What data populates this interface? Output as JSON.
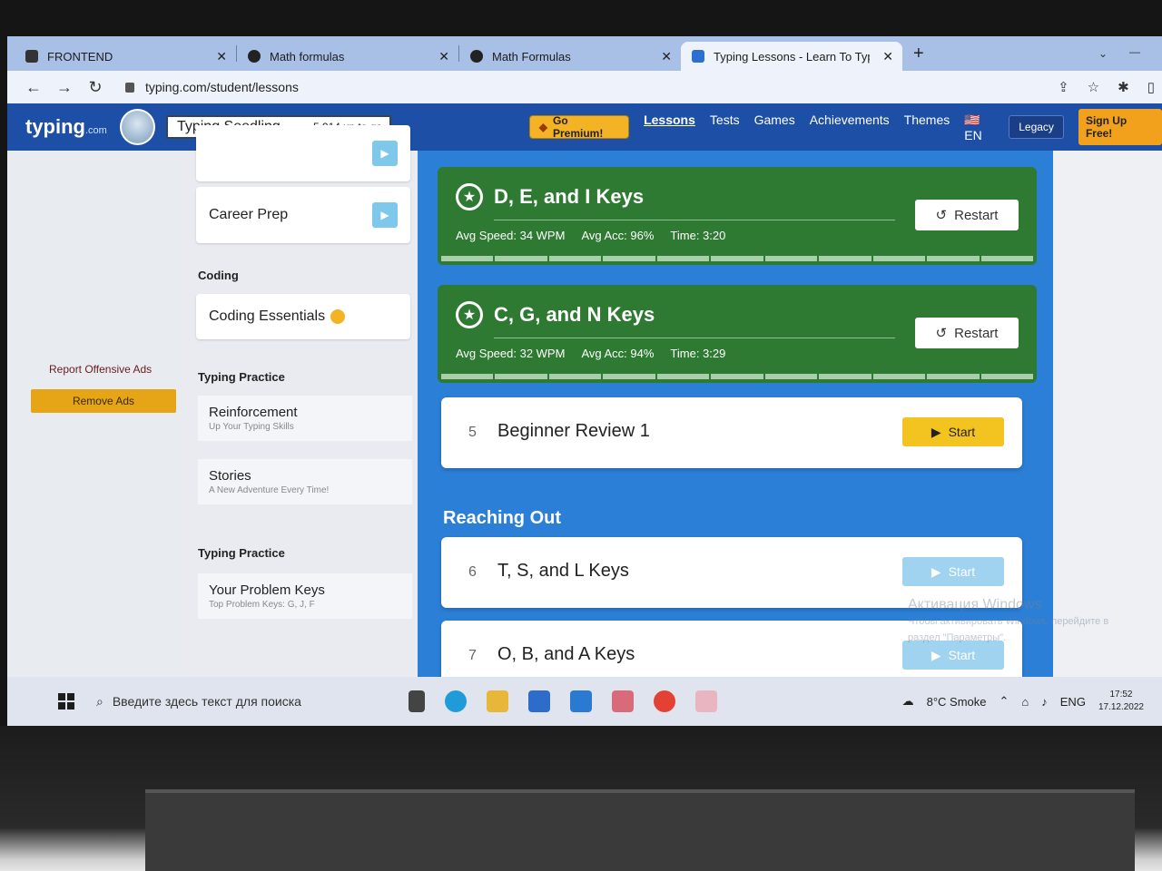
{
  "browser": {
    "tabs": [
      {
        "label": "FRONTEND",
        "active": false
      },
      {
        "label": "Math formulas",
        "active": false
      },
      {
        "label": "Math Formulas",
        "active": false
      },
      {
        "label": "Typing Lessons - Learn To Type A",
        "active": true
      }
    ],
    "new_tab": "+",
    "url": "typing.com/student/lessons"
  },
  "header": {
    "logo": "typing",
    "logo_suffix": ".com",
    "rank": "Typing Seedling...",
    "xp": "5 914 xp to go",
    "premium_label": "Go Premium!",
    "nav": [
      "Lessons",
      "Tests",
      "Games",
      "Achievements",
      "Themes",
      "EN"
    ],
    "legacy": "Legacy",
    "signup": "Sign Up Free!"
  },
  "ads": {
    "report": "Report Offensive Ads",
    "remove": "Remove Ads"
  },
  "sidebar": {
    "career_prep": "Career Prep",
    "coding_heading": "Coding",
    "coding_essentials": "Coding Essentials",
    "typing_practice_heading": "Typing Practice",
    "practice_items": [
      {
        "title": "Reinforcement",
        "subtitle": "Up Your Typing Skills"
      },
      {
        "title": "Stories",
        "subtitle": "A New Adventure Every Time!"
      }
    ],
    "typing_practice_heading_2": "Typing Practice",
    "problem_keys": {
      "title": "Your Problem Keys",
      "subtitle": "Top Problem Keys: G, J, F"
    }
  },
  "lessons": {
    "completed": [
      {
        "title": "D, E, and I Keys",
        "speed": "Avg Speed: 34 WPM",
        "acc": "Avg Acc: 96%",
        "time": "Time: 3:20",
        "button": "Restart"
      },
      {
        "title": "C, G, and N Keys",
        "speed": "Avg Speed: 32 WPM",
        "acc": "Avg Acc: 94%",
        "time": "Time: 3:29",
        "button": "Restart"
      }
    ],
    "pending": [
      {
        "num": "5",
        "title": "Beginner Review 1",
        "button": "Start"
      }
    ],
    "section_title": "Reaching Out",
    "section_lessons": [
      {
        "num": "6",
        "title": "T, S, and L Keys",
        "button": "Start"
      },
      {
        "num": "7",
        "title": "O, B, and A Keys",
        "button": "Start"
      }
    ]
  },
  "watermark": {
    "line1": "Активация Windows",
    "line2": "Чтобы активировать Windows, перейдите в",
    "line3": "раздел \"Параметры\"."
  },
  "taskbar": {
    "search_placeholder": "Введите здесь текст для поиска",
    "weather": "8°C  Smoke",
    "lang": "ENG",
    "time": "17:52",
    "date": "17.12.2022"
  },
  "colors": {
    "header_blue": "#1d4fa6",
    "main_blue": "#2b7fd6",
    "lesson_green": "#2f7a33",
    "start_yellow": "#f3c320",
    "premium_gold": "#f3b324"
  }
}
